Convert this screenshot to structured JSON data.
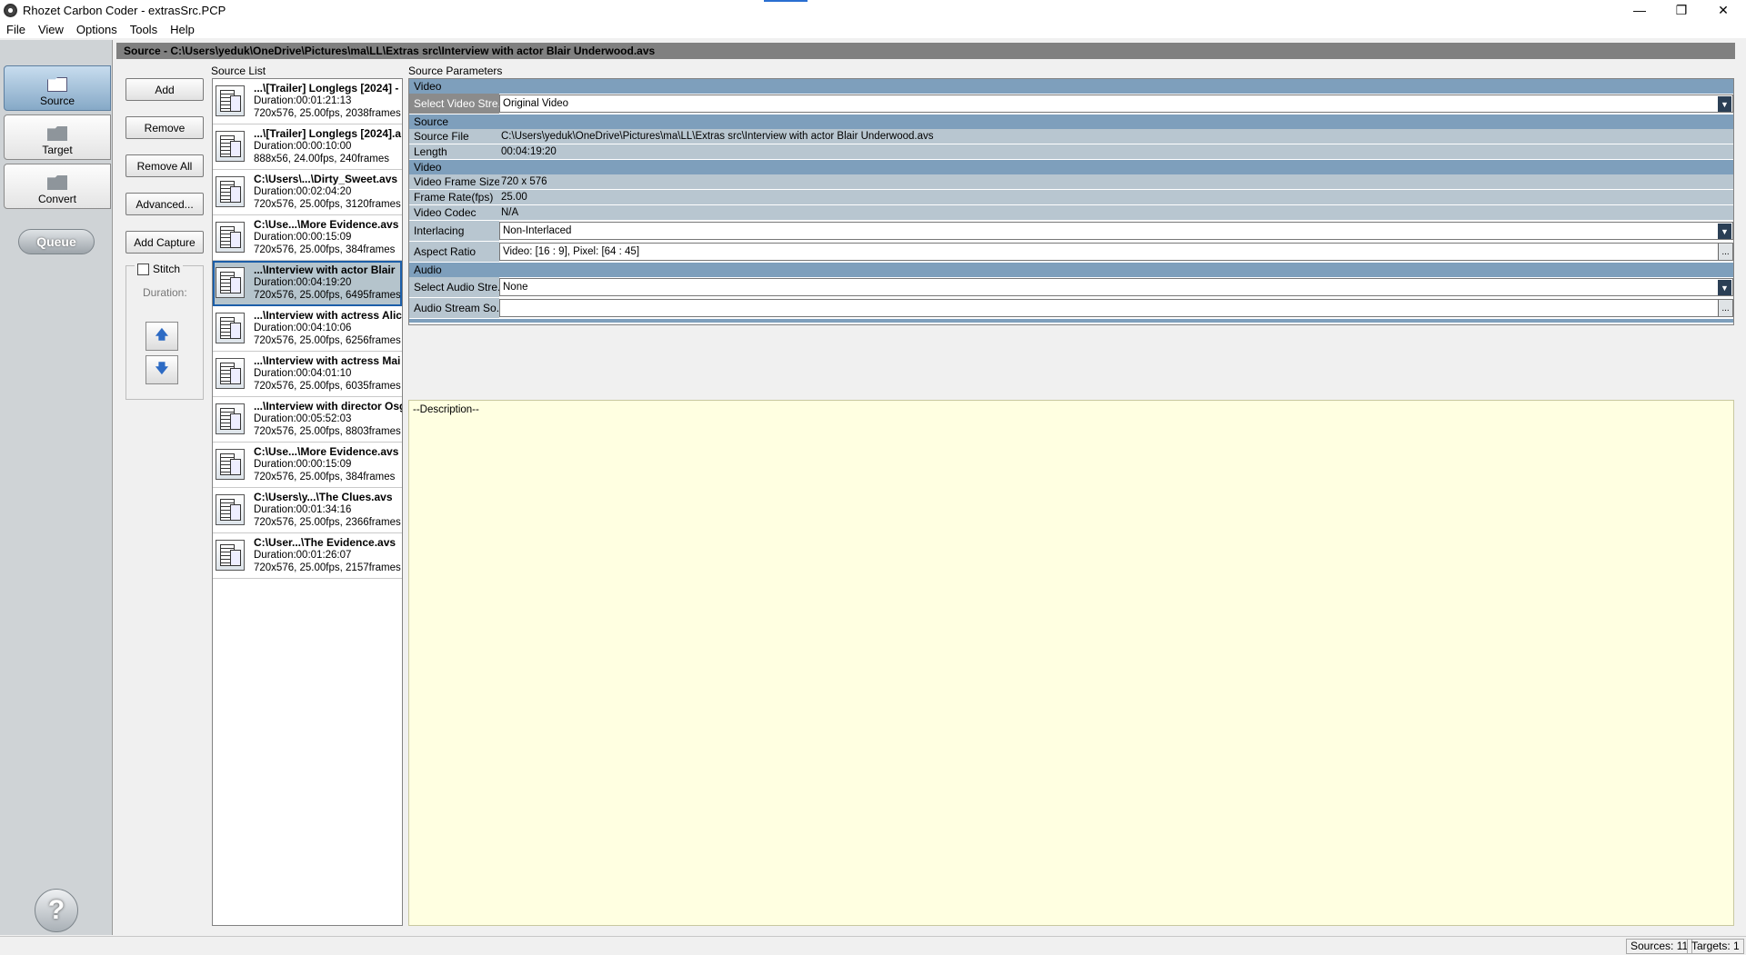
{
  "window": {
    "title": "Rhozet Carbon Coder - extrasSrc.PCP",
    "minimize": "—",
    "maximize": "❐",
    "close": "✕"
  },
  "menu": [
    "File",
    "View",
    "Options",
    "Tools",
    "Help"
  ],
  "nav": {
    "source": "Source",
    "target": "Target",
    "convert": "Convert",
    "queue": "Queue",
    "help": "?"
  },
  "header": "Source - C:\\Users\\yeduk\\OneDrive\\Pictures\\ma\\LL\\Extras src\\Interview with actor Blair Underwood.avs",
  "buttons": {
    "add": "Add",
    "remove": "Remove",
    "remove_all": "Remove All",
    "advanced": "Advanced...",
    "add_capture": "Add Capture",
    "stitch": "Stitch",
    "duration": "Duration:",
    "up": "🡅",
    "down": "🡇"
  },
  "source_list": {
    "title": "Source List",
    "items": [
      {
        "name": "...\\[Trailer] Longlegs [2024] - ",
        "duration": "Duration:00:01:21:13",
        "info": "720x576, 25.00fps, 2038frames"
      },
      {
        "name": "...\\[Trailer] Longlegs [2024].a",
        "duration": "Duration:00:00:10:00",
        "info": "888x56, 24.00fps, 240frames"
      },
      {
        "name": "C:\\Users\\...\\Dirty_Sweet.avs",
        "duration": "Duration:00:02:04:20",
        "info": "720x576, 25.00fps, 3120frames"
      },
      {
        "name": "C:\\Use...\\More Evidence.avs",
        "duration": "Duration:00:00:15:09",
        "info": "720x576, 25.00fps, 384frames"
      },
      {
        "name": "...\\Interview with actor Blair",
        "duration": "Duration:00:04:19:20",
        "info": "720x576, 25.00fps, 6495frames"
      },
      {
        "name": "...\\Interview with actress Alic",
        "duration": "Duration:00:04:10:06",
        "info": "720x576, 25.00fps, 6256frames"
      },
      {
        "name": "...\\Interview with actress Mai",
        "duration": "Duration:00:04:01:10",
        "info": "720x576, 25.00fps, 6035frames"
      },
      {
        "name": "...\\Interview with director Osg",
        "duration": "Duration:00:05:52:03",
        "info": "720x576, 25.00fps, 8803frames"
      },
      {
        "name": "C:\\Use...\\More Evidence.avs",
        "duration": "Duration:00:00:15:09",
        "info": "720x576, 25.00fps, 384frames"
      },
      {
        "name": "C:\\Users\\y...\\The Clues.avs",
        "duration": "Duration:00:01:34:16",
        "info": "720x576, 25.00fps, 2366frames"
      },
      {
        "name": "C:\\User...\\The Evidence.avs",
        "duration": "Duration:00:01:26:07",
        "info": "720x576, 25.00fps, 2157frames"
      }
    ]
  },
  "params": {
    "title": "Source Parameters",
    "sec_video1": "Video",
    "select_video_label": "Select Video Stre...",
    "select_video_value": "Original Video",
    "sec_source": "Source",
    "source_file_label": "Source File",
    "source_file_value": "C:\\Users\\yeduk\\OneDrive\\Pictures\\ma\\LL\\Extras src\\Interview with actor Blair Underwood.avs",
    "length_label": "Length",
    "length_value": "00:04:19:20",
    "sec_video2": "Video",
    "frame_size_label": "Video Frame Size",
    "frame_size_value": "720 x 576",
    "frame_rate_label": "Frame Rate(fps)",
    "frame_rate_value": "25.00",
    "codec_label": "Video Codec",
    "codec_value": "N/A",
    "interlacing_label": "Interlacing",
    "interlacing_value": "Non-Interlaced",
    "aspect_label": "Aspect Ratio",
    "aspect_value": "Video: [16 : 9], Pixel: [64 : 45]",
    "sec_audio": "Audio",
    "select_audio_label": "Select Audio Stre...",
    "select_audio_value": "None",
    "audio_source_label": "Audio Stream So...",
    "audio_source_value": ""
  },
  "description": "--Description--",
  "status": {
    "sources": "Sources: 11",
    "targets": "Targets: 1"
  },
  "selected_index": 4
}
